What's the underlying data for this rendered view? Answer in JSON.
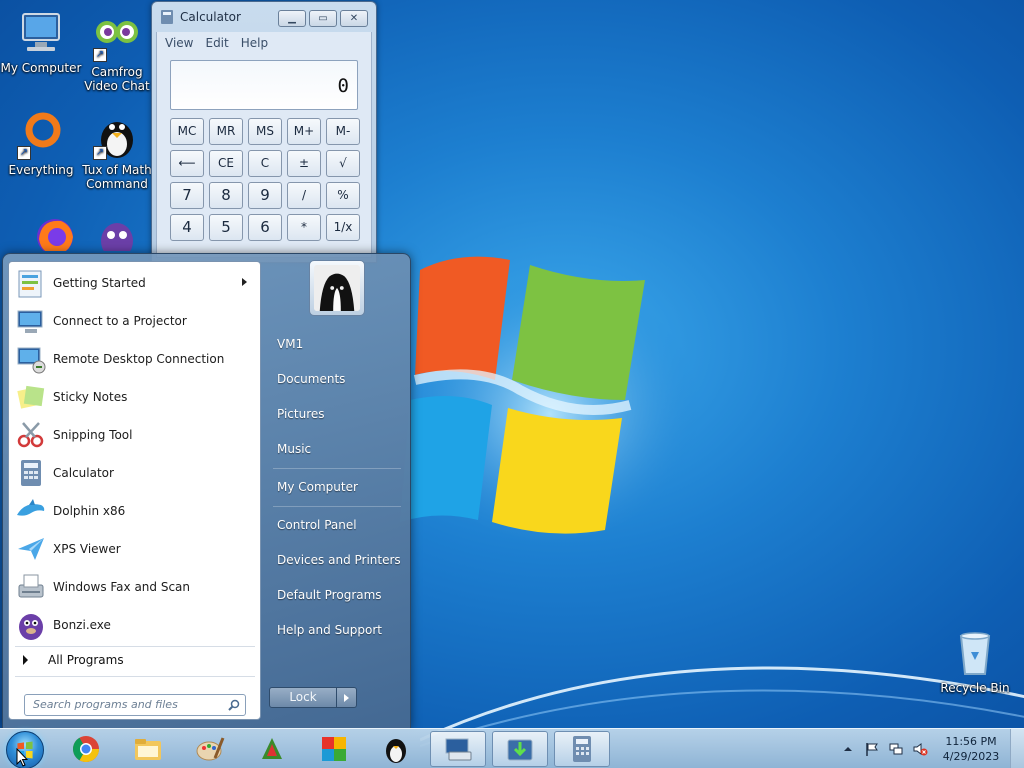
{
  "desktop": {
    "icons": [
      {
        "label": "My Computer"
      },
      {
        "label": "Camfrog Video Chat"
      },
      {
        "label": "Everything"
      },
      {
        "label": "Tux of Math Command"
      },
      {
        "label": "Recycle Bin"
      }
    ]
  },
  "calculator": {
    "title": "Calculator",
    "menu": [
      "View",
      "Edit",
      "Help"
    ],
    "display": "0",
    "keys": [
      "MC",
      "MR",
      "MS",
      "M+",
      "M-",
      "⟵",
      "CE",
      "C",
      "±",
      "√",
      "7",
      "8",
      "9",
      "/",
      "%",
      "4",
      "5",
      "6",
      "*",
      "1/x"
    ]
  },
  "start_menu": {
    "programs": [
      {
        "label": "Getting Started",
        "has_submenu": true
      },
      {
        "label": "Connect to a Projector"
      },
      {
        "label": "Remote Desktop Connection"
      },
      {
        "label": "Sticky Notes"
      },
      {
        "label": "Snipping Tool"
      },
      {
        "label": "Calculator"
      },
      {
        "label": "Dolphin x86"
      },
      {
        "label": "XPS Viewer"
      },
      {
        "label": "Windows Fax and Scan"
      },
      {
        "label": "Bonzi.exe"
      }
    ],
    "all_programs": "All Programs",
    "search_placeholder": "Search programs and files",
    "right_links": [
      "VM1",
      "Documents",
      "Pictures",
      "Music",
      "My Computer",
      "Control Panel",
      "Devices and Printers",
      "Default Programs",
      "Help and Support"
    ],
    "lock_label": "Lock"
  },
  "taskbar": {
    "pinned": [
      "windows-explorer-icon",
      "chrome-icon",
      "paint-icon",
      "cheat-engine-icon",
      "avg-icon",
      "tux-icon",
      "onscreen-keyboard-icon",
      "download-icon",
      "calculator-icon"
    ],
    "clock_time": "11:56 PM",
    "clock_date": "4/29/2023"
  },
  "colors": {
    "desktop_blue": "#1d7fd0",
    "taskbar": "#a9c5de"
  }
}
